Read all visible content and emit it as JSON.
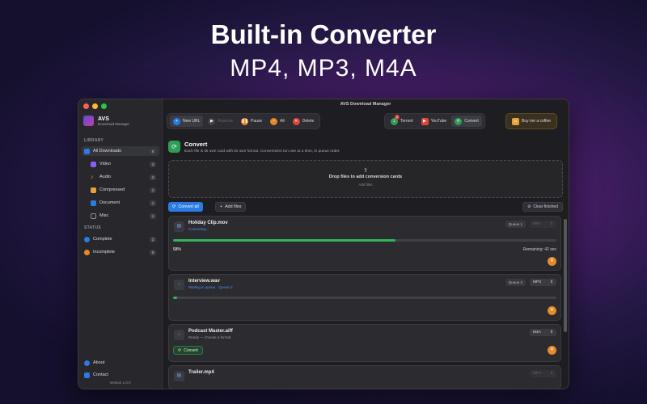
{
  "hero": {
    "title": "Built-in Converter",
    "subtitle": "MP4, MP3, M4A"
  },
  "window": {
    "title": "AVS Download Manager"
  },
  "brand": {
    "name": "AVS",
    "tagline": "Download Manager"
  },
  "sidebar": {
    "library_label": "LIBRARY",
    "items": [
      {
        "label": "All Downloads",
        "count": "8",
        "color": "#2a7be4"
      },
      {
        "label": "Video",
        "count": "3",
        "color": "#8b5cf6"
      },
      {
        "label": "Audio",
        "count": "2",
        "color": "#e8a23a"
      },
      {
        "label": "Compressed",
        "count": "1",
        "color": "#e8a23a"
      },
      {
        "label": "Document",
        "count": "1",
        "color": "#2a7be4"
      },
      {
        "label": "Misc",
        "count": "1",
        "color": "#8e8e96"
      }
    ],
    "status_label": "STATUS",
    "status": [
      {
        "label": "Complete",
        "count": "2",
        "color": "#2a7be4"
      },
      {
        "label": "Incomplete",
        "count": "6",
        "color": "#e8862a"
      }
    ],
    "about": "About",
    "contact": "Contact",
    "version": "Version 1.0.0"
  },
  "toolbar": {
    "new_url": "New URL",
    "resume": "Resume",
    "pause": "Pause",
    "all": "All",
    "delete": "Delete",
    "torrent": "Torrent",
    "torrent_badge": "2",
    "youtube": "YouTube",
    "convert": "Convert",
    "coffee": "Buy me a coffee"
  },
  "converter": {
    "title": "Convert",
    "subtitle": "Each file is its own card with its own format. Conversions run one at a time, in queue order.",
    "drop_title": "Drop files to add conversion cards",
    "drop_sub": "Add files",
    "convert_all": "Convert all",
    "add_files": "Add files",
    "clear_finished": "Clear finished"
  },
  "queue": [
    {
      "name": "Holiday Clip.mov",
      "status": "Converting...",
      "status_color": "#4f93f0",
      "queue": "Queue 1",
      "format": "MP4",
      "progress": 58,
      "percent_label": "58%",
      "remaining": "Remaining: 42 sec"
    },
    {
      "name": "Interview.wav",
      "status": "Waiting in queue · Queue 2",
      "status_color": "#4f93f0",
      "queue": "Queue 2",
      "format": "MP3",
      "progress": 1
    },
    {
      "name": "Podcast Master.aiff",
      "status": "Ready — choose a format",
      "status_color": "#9a9aa2",
      "format": "M4A",
      "convert_label": "Convert"
    },
    {
      "name": "Trailer.mp4",
      "format": "MP4"
    }
  ]
}
